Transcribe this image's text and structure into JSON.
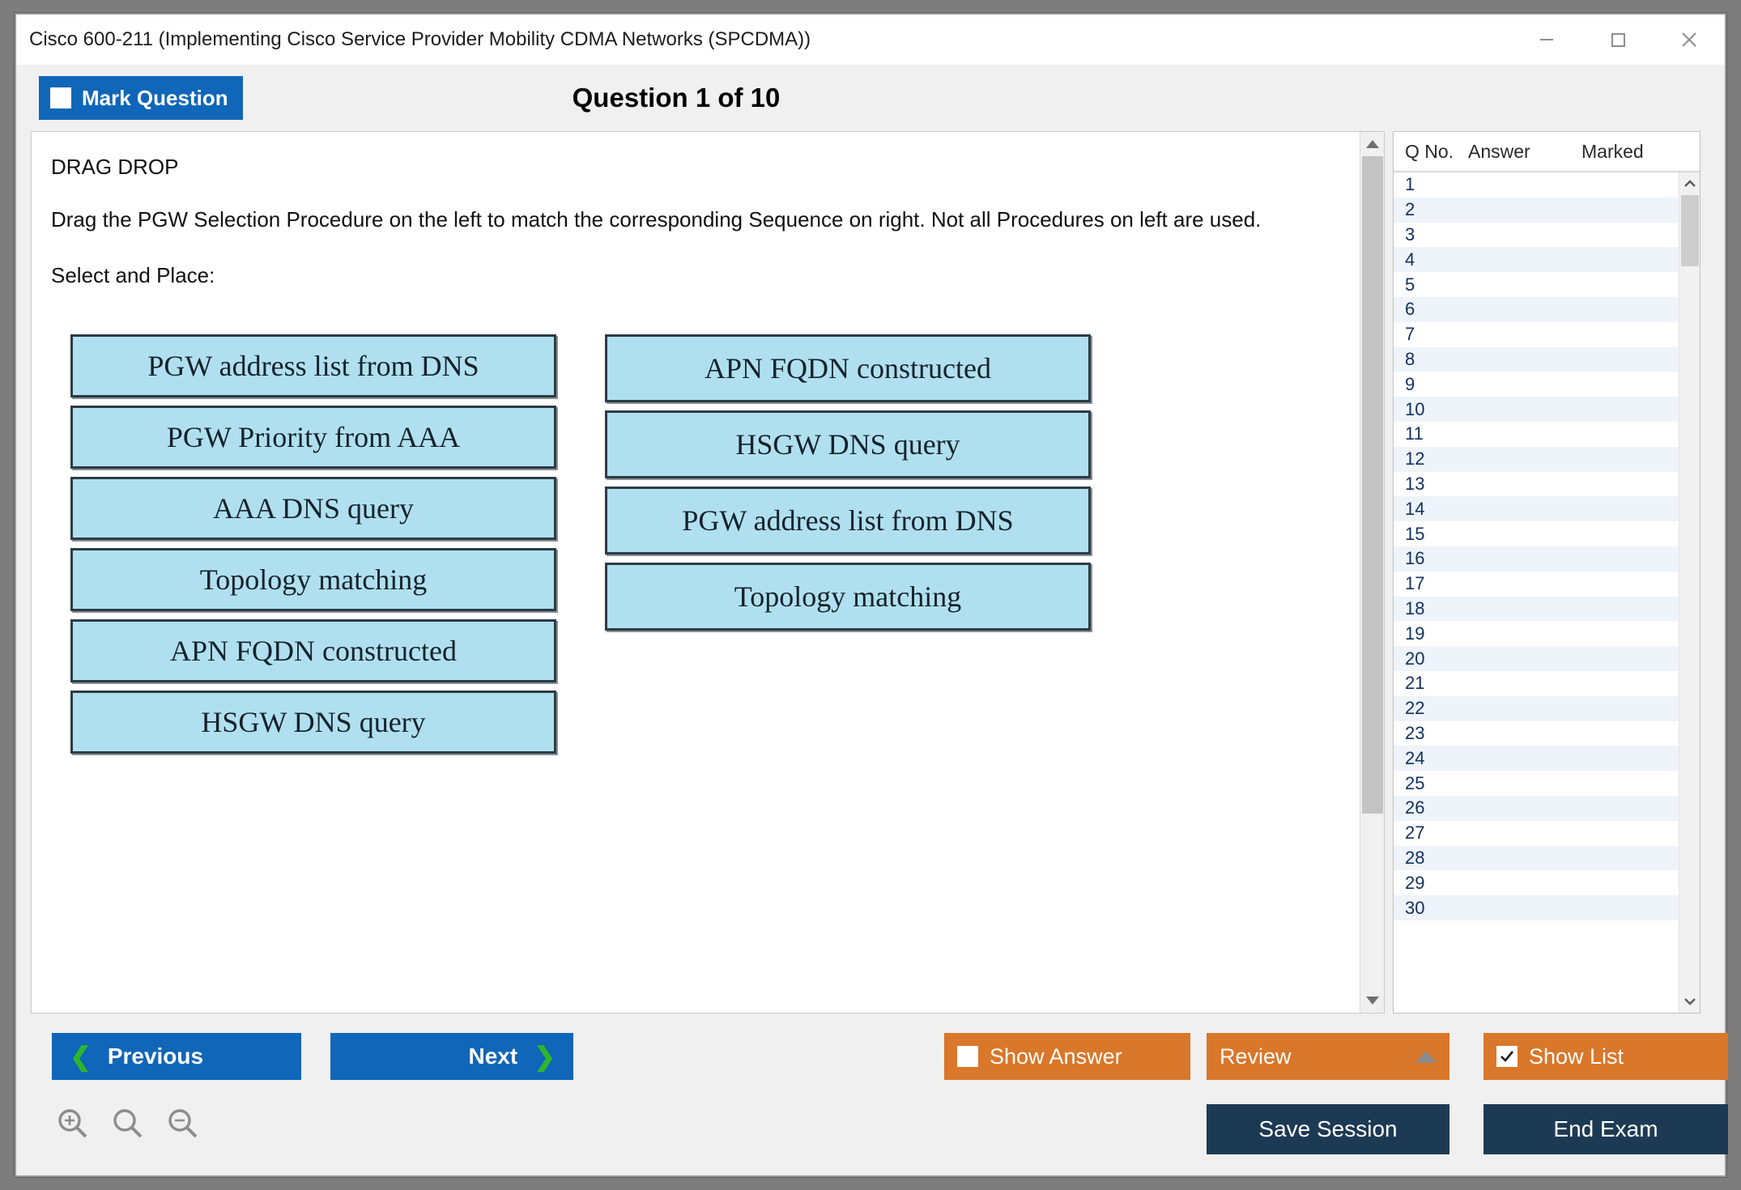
{
  "window": {
    "title": "Cisco 600-211 (Implementing Cisco Service Provider Mobility CDMA Networks (SPCDMA))",
    "minimize_label": "minimize-icon",
    "maximize_label": "maximize-icon",
    "close_label": "close-icon"
  },
  "header": {
    "mark_question_label": "Mark Question",
    "mark_question_checked": false,
    "question_title": "Question 1 of 10"
  },
  "question": {
    "type_label": "DRAG DROP",
    "prompt": "Drag the PGW Selection Procedure on the left to match the corresponding Sequence on right. Not all Procedures on left are used.",
    "instruction": "Select and Place:",
    "left_column": [
      "PGW address list from DNS",
      "PGW Priority from AAA",
      "AAA DNS query",
      "Topology matching",
      "APN FQDN constructed",
      "HSGW DNS query"
    ],
    "right_column": [
      "APN FQDN constructed",
      "HSGW DNS query",
      "PGW address list from DNS",
      "Topology matching"
    ],
    "box_fill_color": "#b0e0ef",
    "box_border_color": "#2c3b46"
  },
  "question_list": {
    "columns": [
      "Q No.",
      "Answer",
      "Marked"
    ],
    "rows": [
      {
        "no": "1",
        "answer": "",
        "marked": ""
      },
      {
        "no": "2",
        "answer": "",
        "marked": ""
      },
      {
        "no": "3",
        "answer": "",
        "marked": ""
      },
      {
        "no": "4",
        "answer": "",
        "marked": ""
      },
      {
        "no": "5",
        "answer": "",
        "marked": ""
      },
      {
        "no": "6",
        "answer": "",
        "marked": ""
      },
      {
        "no": "7",
        "answer": "",
        "marked": ""
      },
      {
        "no": "8",
        "answer": "",
        "marked": ""
      },
      {
        "no": "9",
        "answer": "",
        "marked": ""
      },
      {
        "no": "10",
        "answer": "",
        "marked": ""
      },
      {
        "no": "11",
        "answer": "",
        "marked": ""
      },
      {
        "no": "12",
        "answer": "",
        "marked": ""
      },
      {
        "no": "13",
        "answer": "",
        "marked": ""
      },
      {
        "no": "14",
        "answer": "",
        "marked": ""
      },
      {
        "no": "15",
        "answer": "",
        "marked": ""
      },
      {
        "no": "16",
        "answer": "",
        "marked": ""
      },
      {
        "no": "17",
        "answer": "",
        "marked": ""
      },
      {
        "no": "18",
        "answer": "",
        "marked": ""
      },
      {
        "no": "19",
        "answer": "",
        "marked": ""
      },
      {
        "no": "20",
        "answer": "",
        "marked": ""
      },
      {
        "no": "21",
        "answer": "",
        "marked": ""
      },
      {
        "no": "22",
        "answer": "",
        "marked": ""
      },
      {
        "no": "23",
        "answer": "",
        "marked": ""
      },
      {
        "no": "24",
        "answer": "",
        "marked": ""
      },
      {
        "no": "25",
        "answer": "",
        "marked": ""
      },
      {
        "no": "26",
        "answer": "",
        "marked": ""
      },
      {
        "no": "27",
        "answer": "",
        "marked": ""
      },
      {
        "no": "28",
        "answer": "",
        "marked": ""
      },
      {
        "no": "29",
        "answer": "",
        "marked": ""
      },
      {
        "no": "30",
        "answer": "",
        "marked": ""
      }
    ]
  },
  "footer": {
    "previous_label": "Previous",
    "next_label": "Next",
    "show_answer_label": "Show Answer",
    "show_answer_checked": false,
    "review_label": "Review",
    "show_list_label": "Show List",
    "show_list_checked": true,
    "save_session_label": "Save Session",
    "end_exam_label": "End Exam",
    "zoom_in_icon": "zoom-in-icon",
    "zoom_reset_icon": "zoom-reset-icon",
    "zoom_out_icon": "zoom-out-icon"
  },
  "colors": {
    "primary_blue": "#1066b8",
    "accent_orange": "#d9772a",
    "navy": "#1d3a54",
    "chevron_green": "#2db62d"
  }
}
